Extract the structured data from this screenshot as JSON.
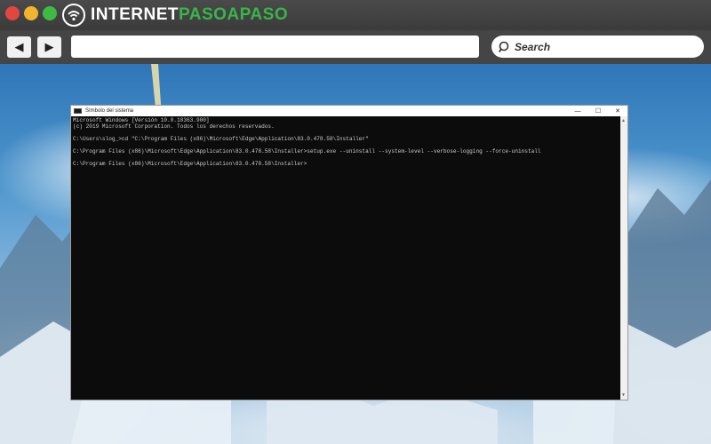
{
  "browser": {
    "logo_left": "INTERNET",
    "logo_right": "PASOAPASO",
    "nav_back": "◀",
    "nav_forward": "▶",
    "address_value": "",
    "search_placeholder": "Search"
  },
  "colors": {
    "chrome": "#3a3a3a",
    "close": "#e2463f",
    "minimize": "#f0b52d",
    "zoom": "#3fbb45",
    "brand_green": "#39b54a",
    "console_bg": "#0c0c0c",
    "console_text": "#cccccc"
  },
  "cmd_window": {
    "title": "Símbolo del sistema",
    "minimize": "—",
    "maximize": "☐",
    "close": "✕",
    "scroll_up": "▲",
    "scroll_down": "▼",
    "lines": [
      "Microsoft Windows [Versión 10.0.18363.900]",
      "(c) 2019 Microsoft Corporation. Todos los derechos reservados.",
      "",
      "C:\\Users\\slog_>cd \"C:\\Program Files (x86)\\Microsoft\\Edge\\Application\\83.0.478.58\\Installer\"",
      "",
      "C:\\Program Files (x86)\\Microsoft\\Edge\\Application\\83.0.478.58\\Installer>setup.exe --uninstall --system-level --verbose-logging --force-uninstall",
      "",
      "C:\\Program Files (x86)\\Microsoft\\Edge\\Application\\83.0.478.58\\Installer>"
    ]
  }
}
